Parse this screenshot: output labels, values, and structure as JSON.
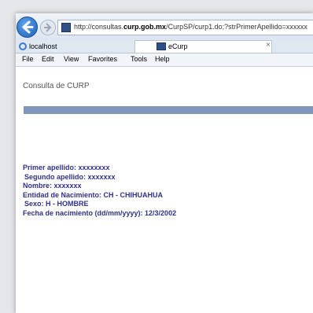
{
  "browser": {
    "address_url_prefix": "http://consultas.",
    "address_url_domain": "curp.gob.mx",
    "address_url_suffix": "/CurpSP/curp1.do;?strPrimerApellido=xxxxxx",
    "favorites_item": "localhost",
    "tab_title": "eCurp",
    "tab_close": "×"
  },
  "menu": {
    "file": "File",
    "edit": "Edit",
    "view": "View",
    "favorites": "Favorites",
    "tools": "Tools",
    "help": "Help"
  },
  "page": {
    "header": "Consulta de CURP",
    "bar_color": "#7f96bd",
    "details": [
      "Primer apellido: xxxxxxxx",
      "Segundo apellido: xxxxxxx",
      "Nombre: xxxxxxx",
      "Entidad de Nacimiento: CH - CHIHUAHUA",
      "Sexo: H - HOMBRE",
      "Fecha de nacimiento (dd/mm/yyyy): 12/3/2002"
    ]
  },
  "colors": {
    "detail_text": "#2f318a",
    "back_button": "#1a5fb4"
  },
  "icons": {
    "back": "back-arrow-icon",
    "forward": "forward-arrow-icon",
    "favicon": "site-favicon-icon",
    "ie": "ie-logo-icon"
  }
}
